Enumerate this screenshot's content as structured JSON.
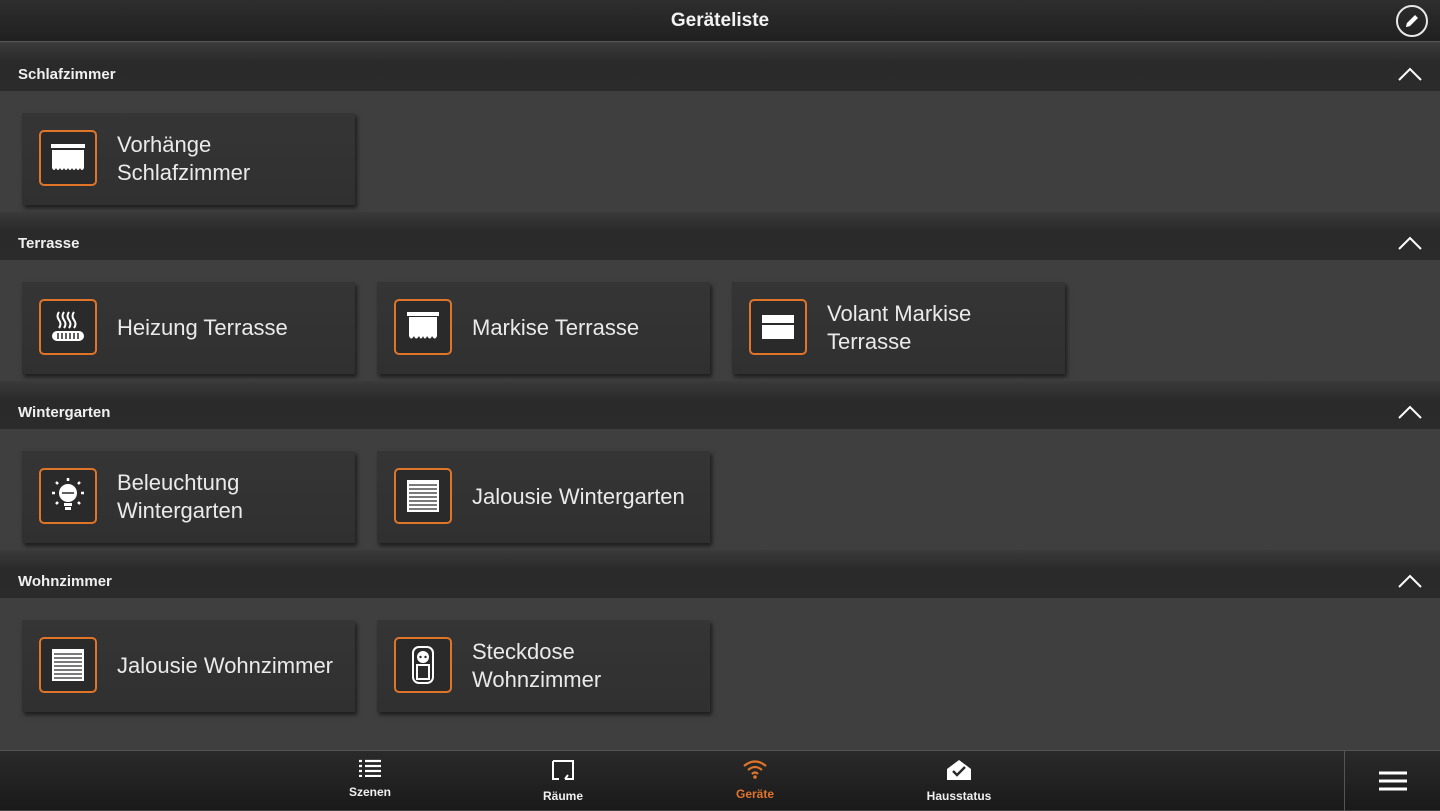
{
  "header": {
    "title": "Geräteliste",
    "edit_icon": "pencil-icon"
  },
  "accent_color": "#e0752a",
  "sections": [
    {
      "label": "Schlafzimmer",
      "devices": [
        {
          "name": "Vorhänge Schlafzimmer",
          "icon": "curtain-icon"
        }
      ]
    },
    {
      "label": "Terrasse",
      "devices": [
        {
          "name": "Heizung Terrasse",
          "icon": "heater-icon"
        },
        {
          "name": "Markise Terrasse",
          "icon": "awning-icon"
        },
        {
          "name": "Volant Markise Terrasse",
          "icon": "awning-valance-icon"
        }
      ]
    },
    {
      "label": "Wintergarten",
      "devices": [
        {
          "name": "Beleuchtung Wintergarten",
          "icon": "light-bulb-icon"
        },
        {
          "name": "Jalousie Wintergarten",
          "icon": "blind-icon"
        }
      ]
    },
    {
      "label": "Wohnzimmer",
      "devices": [
        {
          "name": "Jalousie Wohnzimmer",
          "icon": "blind-icon"
        },
        {
          "name": "Steckdose Wohnzimmer",
          "icon": "socket-icon"
        }
      ]
    }
  ],
  "nav": {
    "items": [
      {
        "label": "Szenen",
        "icon": "list-icon"
      },
      {
        "label": "Räume",
        "icon": "room-icon"
      },
      {
        "label": "Geräte",
        "icon": "wifi-icon",
        "active": true
      },
      {
        "label": "Hausstatus",
        "icon": "house-check-icon"
      }
    ],
    "menu_icon": "hamburger-menu-icon"
  }
}
